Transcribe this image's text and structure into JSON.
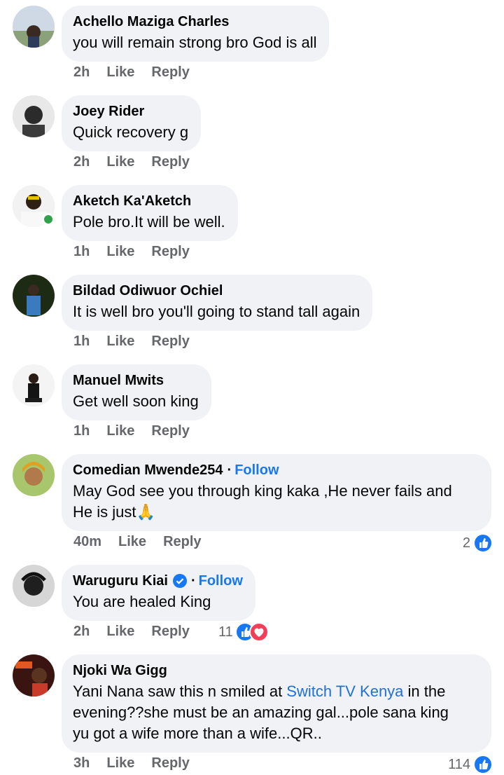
{
  "colors": {
    "link": "#216fdb",
    "follow": "#1877f2",
    "bubble": "#f0f2f5",
    "meta": "#65676b",
    "online": "#31a24c"
  },
  "labels": {
    "like": "Like",
    "reply": "Reply",
    "follow": "Follow"
  },
  "comments": [
    {
      "author": "Achello Maziga Charles",
      "text": "you will remain strong bro God is all",
      "time": "2h"
    },
    {
      "author": "Joey Rider",
      "text": "Quick recovery g",
      "time": "2h"
    },
    {
      "author": "Aketch Ka'Aketch",
      "text": "Pole bro.It will be well.",
      "time": "1h",
      "online": true
    },
    {
      "author": "Bildad Odiwuor Ochiel",
      "text": "It is well bro you'll going to stand tall again",
      "time": "1h"
    },
    {
      "author": "Manuel Mwits",
      "text": "Get well soon king",
      "time": "1h"
    },
    {
      "author": "Comedian Mwende254",
      "text_line1": "May God see you through king kaka ,He never fails and",
      "text_line2": "He is just",
      "emoji": "🙏",
      "time": "40m",
      "follow": true,
      "reaction_count": "2",
      "reaction_icons": [
        "like-icon"
      ]
    },
    {
      "author": "Waruguru Kiai",
      "text": "You are healed King",
      "time": "2h",
      "follow": true,
      "verified": true,
      "reaction_count": "11",
      "reaction_icons": [
        "like-icon",
        "love-icon"
      ]
    },
    {
      "author": "Njoki Wa Gigg",
      "text_before_link": "Yani Nana saw this n smiled at ",
      "link": "Switch TV Kenya",
      "text_after_link": " in the",
      "text_line2": "evening??she must be an amazing gal...pole sana king",
      "text_line3": "yu got a wife more than a wife...QR..",
      "time": "3h",
      "reaction_count": "114",
      "reaction_icons": [
        "like-icon"
      ]
    }
  ]
}
